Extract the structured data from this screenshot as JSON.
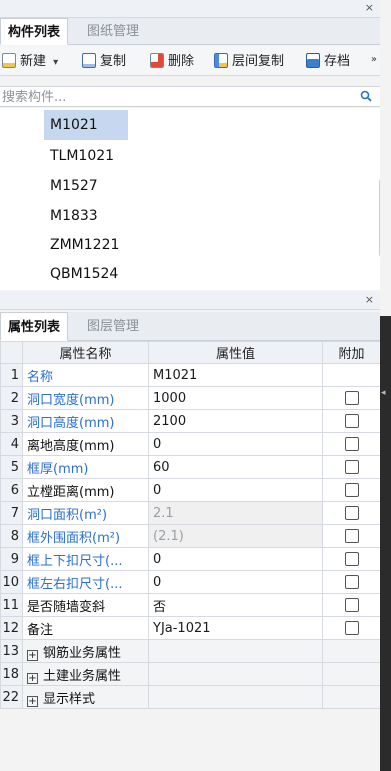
{
  "panel_top": {
    "close": "×"
  },
  "component_panel": {
    "tabs": [
      {
        "label": "构件列表",
        "active": true
      },
      {
        "label": "图纸管理",
        "active": false
      }
    ],
    "toolbar": {
      "new_label": "新建",
      "new_dropdown": "▾",
      "copy_label": "复制",
      "delete_label": "删除",
      "floor_copy_label": "层间复制",
      "archive_label": "存档",
      "more": "»"
    },
    "search": {
      "placeholder": "搜索构件..."
    },
    "items": [
      "M1021",
      "TLM1021",
      "M1527",
      "M1833",
      "ZMM1221",
      "QBM1524"
    ],
    "selected_index": 0
  },
  "property_panel": {
    "close": "×",
    "tabs": [
      {
        "label": "属性列表",
        "active": true
      },
      {
        "label": "图层管理",
        "active": false
      }
    ],
    "columns": [
      "属性名称",
      "属性值",
      "附加"
    ],
    "rows": [
      {
        "num": "1",
        "name": "名称",
        "value": "M1021",
        "name_color": "blue",
        "value_disabled": false,
        "checkbox": false
      },
      {
        "num": "2",
        "name": "洞口宽度(mm)",
        "value": "1000",
        "name_color": "blue",
        "value_disabled": false,
        "checkbox": true
      },
      {
        "num": "3",
        "name": "洞口高度(mm)",
        "value": "2100",
        "name_color": "blue",
        "value_disabled": false,
        "checkbox": true
      },
      {
        "num": "4",
        "name": "离地高度(mm)",
        "value": "0",
        "name_color": "black",
        "value_disabled": false,
        "checkbox": true
      },
      {
        "num": "5",
        "name": "框厚(mm)",
        "value": "60",
        "name_color": "blue",
        "value_disabled": false,
        "checkbox": true
      },
      {
        "num": "6",
        "name": "立樘距离(mm)",
        "value": "0",
        "name_color": "black",
        "value_disabled": false,
        "checkbox": true
      },
      {
        "num": "7",
        "name": "洞口面积(m²)",
        "value": "2.1",
        "name_color": "blue",
        "value_disabled": true,
        "checkbox": true
      },
      {
        "num": "8",
        "name": "框外围面积(m²)",
        "value": "(2.1)",
        "name_color": "blue",
        "value_disabled": true,
        "checkbox": true
      },
      {
        "num": "9",
        "name": "框上下扣尺寸(...",
        "value": "0",
        "name_color": "blue",
        "value_disabled": false,
        "checkbox": true
      },
      {
        "num": "10",
        "name": "框左右扣尺寸(...",
        "value": "0",
        "name_color": "blue",
        "value_disabled": false,
        "checkbox": true
      },
      {
        "num": "11",
        "name": "是否随墙变斜",
        "value": "否",
        "name_color": "black",
        "value_disabled": false,
        "checkbox": true
      },
      {
        "num": "12",
        "name": "备注",
        "value": "YJa-1021",
        "name_color": "black",
        "value_disabled": false,
        "checkbox": true
      }
    ],
    "groups": [
      {
        "num": "13",
        "label": "钢筋业务属性"
      },
      {
        "num": "18",
        "label": "土建业务属性"
      },
      {
        "num": "22",
        "label": "显示样式"
      }
    ],
    "expand_glyph": "+"
  },
  "colors": {
    "accent_blue": "#2a6fd6",
    "selection": "#c5d8ef",
    "header_bg": "#eef1f5"
  },
  "icons": [
    "new-icon",
    "copy-icon",
    "delete-icon",
    "floor-copy-icon",
    "archive-icon",
    "search-icon",
    "close-icon",
    "expand-icon"
  ]
}
